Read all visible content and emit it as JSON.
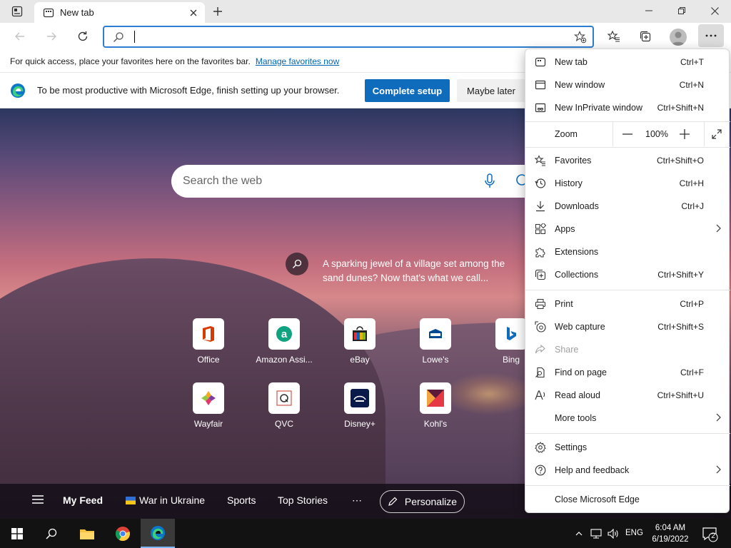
{
  "browser": {
    "tab_title": "New tab",
    "address_value": "",
    "favorites_bar": {
      "text": "For quick access, place your favorites here on the favorites bar.",
      "link": "Manage favorites now"
    },
    "banner": {
      "text": "To be most productive with Microsoft Edge, finish setting up your browser.",
      "primary": "Complete setup",
      "secondary": "Maybe later"
    }
  },
  "newtab": {
    "search_placeholder": "Search the web",
    "story_text": "A sparking jewel of a village set among the sand dunes? Now that's what we call...",
    "tiles": [
      {
        "label": "Office"
      },
      {
        "label": "Amazon Assi..."
      },
      {
        "label": "eBay"
      },
      {
        "label": "Lowe's"
      },
      {
        "label": "Bing"
      },
      {
        "label": "Wayfair"
      },
      {
        "label": "QVC"
      },
      {
        "label": "Disney+"
      },
      {
        "label": "Kohl's"
      }
    ],
    "feed": {
      "my_feed": "My Feed",
      "war": "War in Ukraine",
      "sports": "Sports",
      "top_stories": "Top Stories",
      "more": "⋯",
      "personalize": "Personalize"
    }
  },
  "menu": {
    "new_tab": {
      "label": "New tab",
      "shortcut": "Ctrl+T"
    },
    "new_window": {
      "label": "New window",
      "shortcut": "Ctrl+N"
    },
    "inprivate": {
      "label": "New InPrivate window",
      "shortcut": "Ctrl+Shift+N"
    },
    "zoom": {
      "label": "Zoom",
      "value": "100%"
    },
    "favorites": {
      "label": "Favorites",
      "shortcut": "Ctrl+Shift+O"
    },
    "history": {
      "label": "History",
      "shortcut": "Ctrl+H"
    },
    "downloads": {
      "label": "Downloads",
      "shortcut": "Ctrl+J"
    },
    "apps": {
      "label": "Apps"
    },
    "extensions": {
      "label": "Extensions"
    },
    "collections": {
      "label": "Collections",
      "shortcut": "Ctrl+Shift+Y"
    },
    "print": {
      "label": "Print",
      "shortcut": "Ctrl+P"
    },
    "web_capture": {
      "label": "Web capture",
      "shortcut": "Ctrl+Shift+S"
    },
    "share": {
      "label": "Share"
    },
    "find": {
      "label": "Find on page",
      "shortcut": "Ctrl+F"
    },
    "read_aloud": {
      "label": "Read aloud",
      "shortcut": "Ctrl+Shift+U"
    },
    "more_tools": {
      "label": "More tools"
    },
    "settings": {
      "label": "Settings"
    },
    "help": {
      "label": "Help and feedback"
    },
    "close": {
      "label": "Close Microsoft Edge"
    }
  },
  "taskbar": {
    "lang": "ENG",
    "time": "6:04 AM",
    "date": "6/19/2022",
    "notifications": "2"
  },
  "colors": {
    "accent": "#0f6cbd",
    "address_border": "#2d7dd2",
    "link": "#0066b4"
  }
}
